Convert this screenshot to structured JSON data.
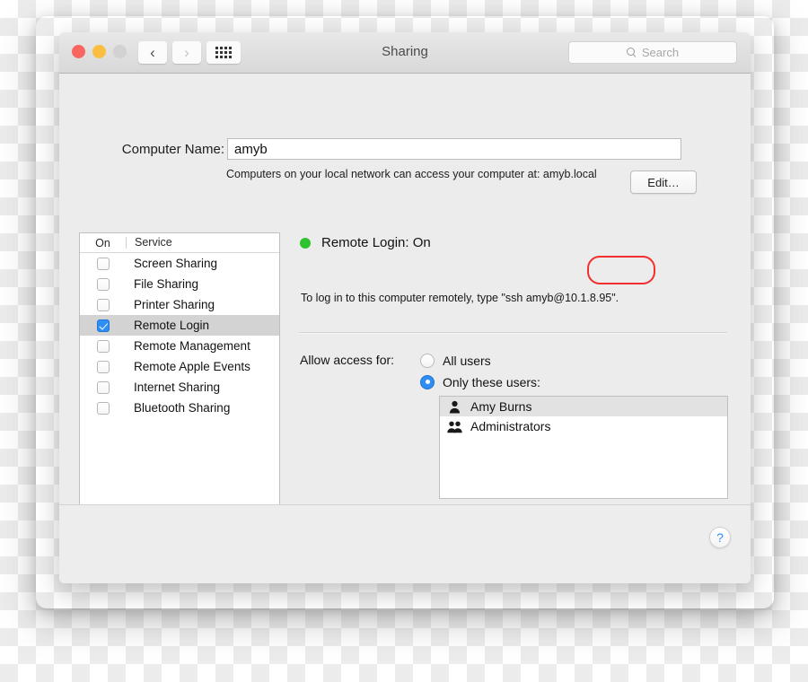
{
  "window": {
    "title": "Sharing",
    "traffic_lights": [
      "close-red",
      "minimize-yellow",
      "zoom-gray"
    ],
    "nav": {
      "back": "‹",
      "forward": "›",
      "grid": "grid-icon"
    },
    "search": {
      "placeholder": "Search",
      "value": ""
    }
  },
  "computer_name": {
    "label": "Computer Name:",
    "value": "amyb",
    "description": "Computers on your local network can access your computer at: amyb.local",
    "edit_button": "Edit…"
  },
  "services": {
    "columns": {
      "on": "On",
      "service": "Service"
    },
    "items": [
      {
        "label": "Screen Sharing",
        "on": false,
        "selected": false
      },
      {
        "label": "File Sharing",
        "on": false,
        "selected": false
      },
      {
        "label": "Printer Sharing",
        "on": false,
        "selected": false
      },
      {
        "label": "Remote Login",
        "on": true,
        "selected": true
      },
      {
        "label": "Remote Management",
        "on": false,
        "selected": false
      },
      {
        "label": "Remote Apple Events",
        "on": false,
        "selected": false
      },
      {
        "label": "Internet Sharing",
        "on": false,
        "selected": false
      },
      {
        "label": "Bluetooth Sharing",
        "on": false,
        "selected": false
      }
    ]
  },
  "detail": {
    "status_title": "Remote Login: On",
    "status_color": "#2fc32f",
    "ssh_instruction": "To log in to this computer remotely, type \"ssh amyb@10.1.8.95\".",
    "annotation": {
      "shape": "ellipse",
      "color": "#f22f2f",
      "target": "10.1.8.95"
    },
    "allow_access_label": "Allow access for:",
    "access_options": [
      {
        "label": "All users",
        "selected": false
      },
      {
        "label": "Only these users:",
        "selected": true
      }
    ],
    "users": [
      {
        "name": "Amy Burns",
        "icon": "user-icon",
        "selected": true
      },
      {
        "name": "Administrators",
        "icon": "group-icon",
        "selected": false
      }
    ],
    "add_button": "+",
    "remove_button": "−"
  },
  "footer": {
    "help_button": "?"
  }
}
